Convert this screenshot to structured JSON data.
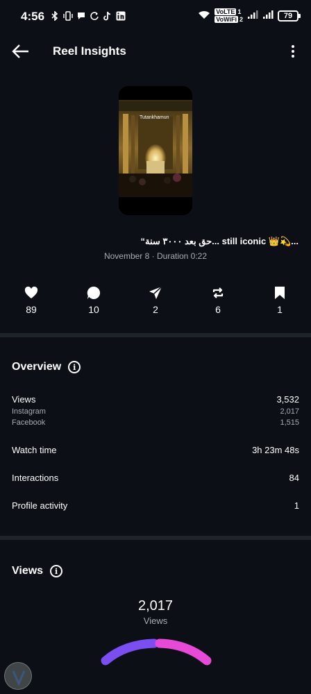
{
  "status_bar": {
    "time": "4:56",
    "sim1_label": "VoLTE",
    "sim1_num": "1",
    "sim2_label": "VoWiFi",
    "sim2_num": "2",
    "battery": "79"
  },
  "header": {
    "title": "Reel Insights"
  },
  "reel": {
    "thumbnail_text": "Tutankhamun",
    "caption": "“حق بعد ٣٠٠٠ سنة... still iconic 👑💫...",
    "meta": "November 8 · Duration 0:22"
  },
  "stats": [
    {
      "icon": "heart-icon",
      "value": "89"
    },
    {
      "icon": "comment-icon",
      "value": "10"
    },
    {
      "icon": "share-icon",
      "value": "2"
    },
    {
      "icon": "repost-icon",
      "value": "6"
    },
    {
      "icon": "save-icon",
      "value": "1"
    }
  ],
  "overview": {
    "title": "Overview",
    "views": {
      "label": "Views",
      "value": "3,532"
    },
    "instagram": {
      "label": "Instagram",
      "value": "2,017"
    },
    "facebook": {
      "label": "Facebook",
      "value": "1,515"
    },
    "watch_time": {
      "label": "Watch time",
      "value": "3h 23m 48s"
    },
    "interactions": {
      "label": "Interactions",
      "value": "84"
    },
    "profile_activity": {
      "label": "Profile activity",
      "value": "1"
    }
  },
  "views_section": {
    "title": "Views",
    "total": "2,017",
    "total_label": "Views"
  },
  "colors": {
    "background": "#0c1016",
    "divider": "#1f242b",
    "secondary_text": "#a8adb4",
    "gauge_purple": "#7a4ef0",
    "gauge_pink": "#e84ad8"
  }
}
